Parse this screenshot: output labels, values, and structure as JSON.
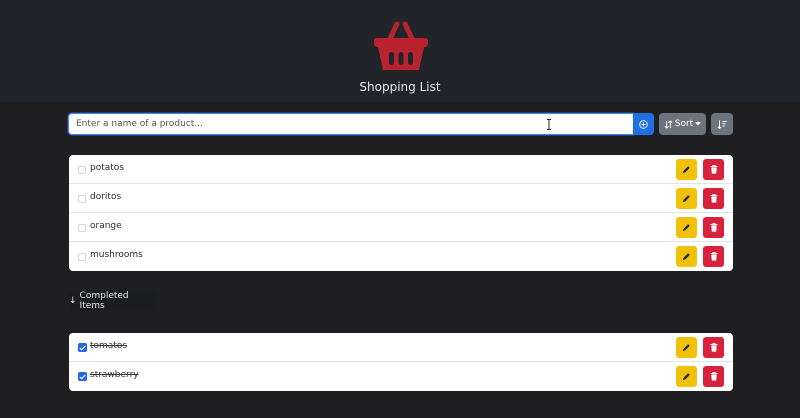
{
  "header": {
    "title": "Shopping List",
    "logo_icon": "shopping-basket-icon",
    "logo_color": "#b8232f"
  },
  "search": {
    "placeholder": "Enter a name of a product...",
    "value": "",
    "add_icon": "plus-circle-icon"
  },
  "toolbar": {
    "sort_label": "Sort",
    "sort_icon": "sort-arrows-icon",
    "order_icon": "sort-descending-icon"
  },
  "active_items": [
    {
      "name": "potatos",
      "checked": false
    },
    {
      "name": "doritos",
      "checked": false
    },
    {
      "name": "orange",
      "checked": false
    },
    {
      "name": "mushrooms",
      "checked": false
    }
  ],
  "completed_toggle": {
    "label": "Completed Items",
    "arrow": "↓"
  },
  "completed_items": [
    {
      "name": "tomatos",
      "checked": true
    },
    {
      "name": "strawberry",
      "checked": true
    }
  ],
  "colors": {
    "primary": "#1f6fe5",
    "edit": "#f2c20b",
    "delete": "#d8213d",
    "secondary": "#6c757d"
  }
}
